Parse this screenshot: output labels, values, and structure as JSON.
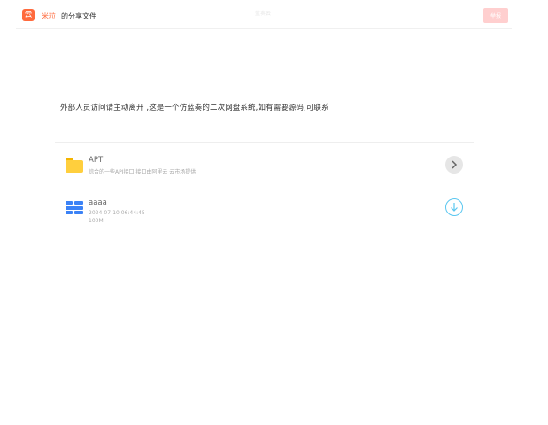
{
  "header": {
    "logo_glyph": "云",
    "username": "米粒",
    "subtitle": "的分享文件",
    "center_title": "蓝奏云",
    "share_label": "举报"
  },
  "notice": "外部人员访问请主动离开 ,这是一个仿蓝奏的二次网盘系统,如有需要源码,可联系",
  "files": [
    {
      "type": "folder",
      "icon": "folder-icon",
      "name": "APT",
      "description": "综合的一些API接口,接口由阿里云 云市场提供"
    },
    {
      "type": "file",
      "icon": "file-icon",
      "name": "aaaa",
      "date": "2024-07-10 06:44:45",
      "size": "100M"
    }
  ],
  "colors": {
    "accent": "#ff6a3d",
    "folder": "#ffcf3d",
    "file": "#3b82f6",
    "download": "#5bc7f0"
  }
}
